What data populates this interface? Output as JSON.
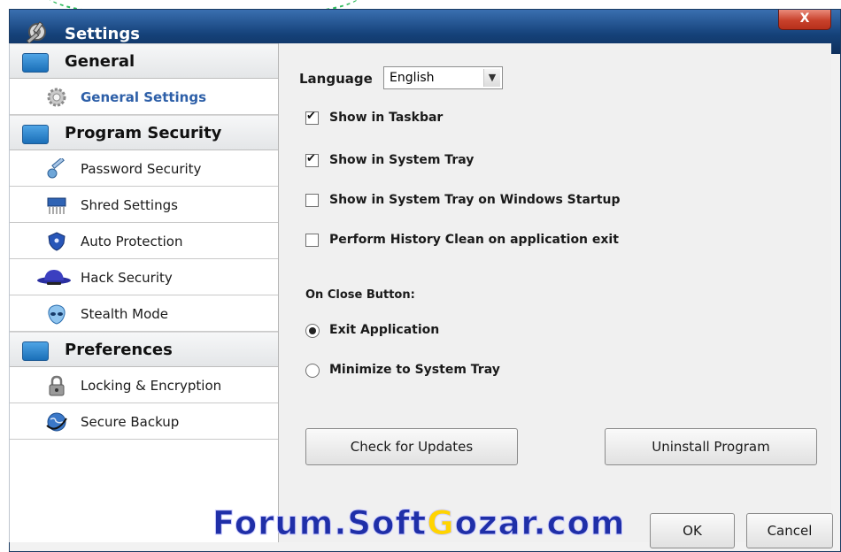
{
  "window": {
    "title": "Settings",
    "close_label": "X"
  },
  "sidebar": {
    "categories": [
      {
        "label": "General",
        "icon": "general-folder-icon"
      },
      {
        "label": "Program Security",
        "icon": "lock-folder-icon"
      },
      {
        "label": "Preferences",
        "icon": "tools-folder-icon"
      }
    ],
    "items": [
      {
        "label": "General Settings",
        "icon": "gear-icon"
      },
      {
        "label": "Password Security",
        "icon": "key-icon"
      },
      {
        "label": "Shred Settings",
        "icon": "shredder-icon"
      },
      {
        "label": "Auto Protection",
        "icon": "shield-icon"
      },
      {
        "label": "Hack Security",
        "icon": "spy-hat-icon"
      },
      {
        "label": "Stealth Mode",
        "icon": "alien-icon"
      },
      {
        "label": "Locking & Encryption",
        "icon": "padlock-icon"
      },
      {
        "label": "Secure Backup",
        "icon": "globe-backup-icon"
      }
    ]
  },
  "main": {
    "language_label": "Language",
    "language_value": "English",
    "checkboxes": [
      {
        "label": "Show in Taskbar",
        "checked": true
      },
      {
        "label": "Show in System Tray",
        "checked": true
      },
      {
        "label": "Show in System Tray on Windows Startup",
        "checked": false
      },
      {
        "label": "Perform History Clean on application exit",
        "checked": false
      }
    ],
    "on_close_label": "On Close Button:",
    "radios": [
      {
        "label": "Exit Application",
        "checked": true
      },
      {
        "label": "Minimize to System Tray",
        "checked": false
      }
    ],
    "check_updates_label": "Check for Updates",
    "uninstall_label": "Uninstall Program",
    "ok_label": "OK",
    "cancel_label": "Cancel"
  },
  "watermark": {
    "before": "Forum.Soft",
    "g": "G",
    "after": "ozar.com"
  }
}
